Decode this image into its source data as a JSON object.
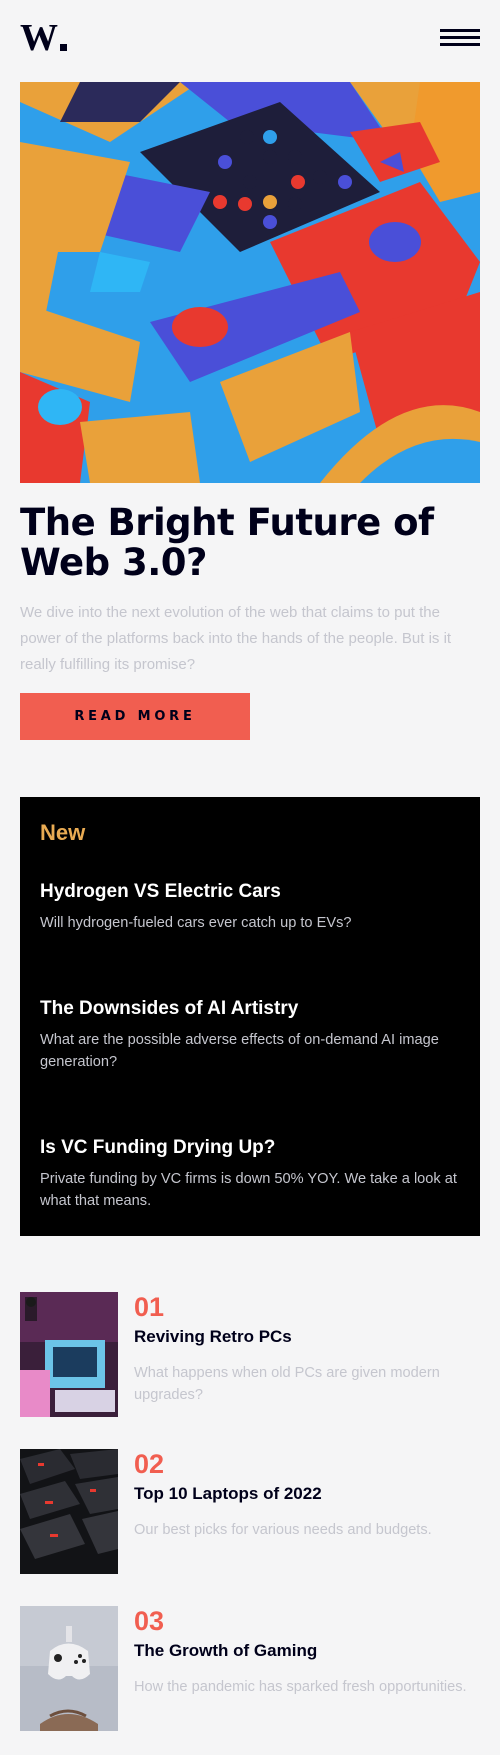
{
  "header": {
    "logo_text": "W.",
    "menu_icon": "hamburger-menu-icon"
  },
  "hero": {
    "image_icon": "abstract-3d-blocks-illustration",
    "title": "The Bright Future of Web 3.0?",
    "description": "We dive into the next evolution of the web that claims to put the power of the platforms back into the hands of the people. But is it really fulfilling its promise?",
    "button_label": "READ MORE"
  },
  "new_section": {
    "heading": "New",
    "items": [
      {
        "title": "Hydrogen VS Electric Cars",
        "description": "Will hydrogen-fueled cars ever catch up to EVs?"
      },
      {
        "title": "The Downsides of AI Artistry",
        "description": "What are the possible adverse effects of on-demand AI image generation?"
      },
      {
        "title": "Is VC Funding Drying Up?",
        "description": "Private funding by VC firms is down 50% YOY. We take a look at what that means."
      }
    ]
  },
  "trending": [
    {
      "number": "01",
      "title": "Reviving Retro PCs",
      "description": "What happens when old PCs are given modern upgrades?",
      "image_icon": "retro-pc-image"
    },
    {
      "number": "02",
      "title": "Top 10 Laptops of 2022",
      "description": "Our best picks for various needs and budgets.",
      "image_icon": "laptop-keyboard-image"
    },
    {
      "number": "03",
      "title": "The Growth of Gaming",
      "description": "How the pandemic has sparked fresh opportunities.",
      "image_icon": "game-controller-image"
    }
  ],
  "colors": {
    "background": "#f5f5f6",
    "dark": "#00001a",
    "accent_red": "#f15e50",
    "accent_orange": "#e9ab53",
    "muted_text": "#c5c6ce"
  }
}
